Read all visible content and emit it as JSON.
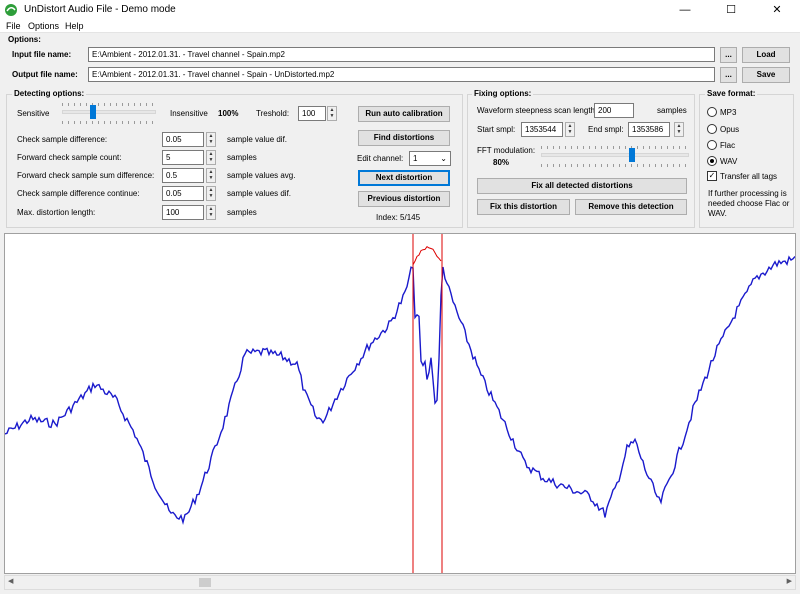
{
  "window": {
    "title": "UnDistort Audio File - Demo mode",
    "minimize": "—",
    "maximize": "☐",
    "close": "✕"
  },
  "menu": [
    "File",
    "Options",
    "Help"
  ],
  "options": {
    "title": "Options:",
    "input_label": "Input file name:",
    "input_value": "E:\\Ambient - 2012.01.31. - Travel channel - Spain.mp2",
    "output_label": "Output file name:",
    "output_value": "E:\\Ambient - 2012.01.31. - Travel channel - Spain - UnDistorted.mp2",
    "browse_label": "...",
    "load_label": "Load",
    "save_label": "Save"
  },
  "detecting": {
    "title": "Detecting options:",
    "sensitive": "Sensitive",
    "insensitive": "Insensitive",
    "percent": "100%",
    "threshold_label": "Treshold:",
    "threshold_value": "100",
    "slider_level": 0.33,
    "rows": [
      {
        "label": "Check sample difference:",
        "value": "0.05",
        "unit": "sample value dif."
      },
      {
        "label": "Forward check sample count:",
        "value": "5",
        "unit": "samples"
      },
      {
        "label": "Forward check sample sum difference:",
        "value": "0.5",
        "unit": "sample values avg."
      },
      {
        "label": "Check sample difference continue:",
        "value": "0.05",
        "unit": "sample values dif."
      },
      {
        "label": "Max. distortion length:",
        "value": "100",
        "unit": "samples"
      }
    ],
    "run_auto": "Run auto calibration",
    "find": "Find distortions",
    "edit_channel_label": "Edit channel:",
    "edit_channel_value": "1",
    "next": "Next distortion",
    "previous": "Previous distortion",
    "index": "Index: 5/145"
  },
  "fixing": {
    "title": "Fixing options:",
    "scan_label": "Waveform steepness scan length:",
    "scan_value": "200",
    "scan_unit": "samples",
    "start_label": "Start smpl:",
    "start_value": "1353544",
    "end_label": "End smpl:",
    "end_value": "1353586",
    "fft_label": "FFT modulation:",
    "fft_value": "80%",
    "fft_level": 0.8,
    "fix_all": "Fix all detected distortions",
    "fix_this": "Fix this distortion",
    "remove": "Remove this detection"
  },
  "save_format": {
    "title": "Save format:",
    "options": [
      "MP3",
      "Opus",
      "Flac",
      "WAV"
    ],
    "selected": "WAV",
    "transfer_tags": "Transfer all tags",
    "note": "If further processing is needed choose Flac or WAV."
  },
  "colors": {
    "waveform": "#1a1acc",
    "marker": "#dd0000",
    "accent": "#0078d7"
  }
}
